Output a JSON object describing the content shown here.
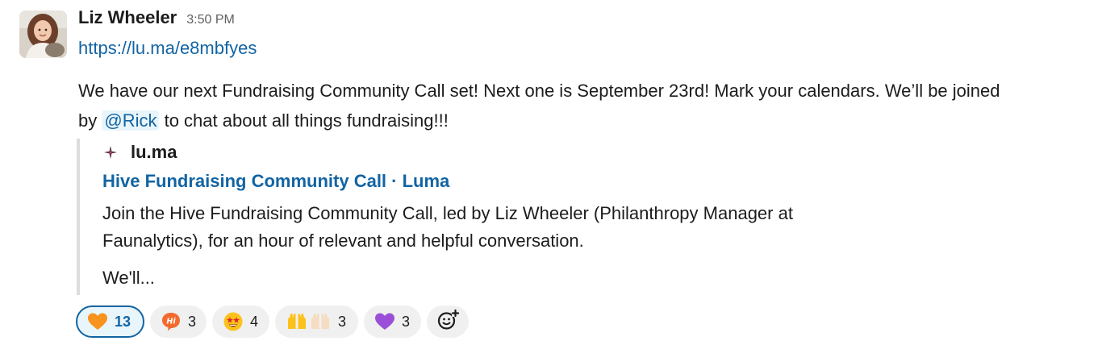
{
  "message": {
    "author": "Liz Wheeler",
    "time": "3:50 PM",
    "link": "https://lu.ma/e8mbfyes",
    "text_line1": "We have our next Fundraising Community Call set! Next one is September 23rd! Mark your calendars. We’ll be joined",
    "text_line2_prefix": "by ",
    "mention": "@Rick",
    "text_line2_suffix": " to chat about all things fundraising!!!"
  },
  "unfurl": {
    "site_icon": "luma-sparkle-icon",
    "site_name": "lu.ma",
    "title": "Hive Fundraising Community Call · Luma",
    "desc_line1": "Join the Hive Fundraising Community Call, led by Liz Wheeler (Philanthropy Manager at",
    "desc_line2": "Faunalytics), for an hour of relevant and helpful conversation.",
    "more": "We'll..."
  },
  "reactions": [
    {
      "emoji": "orange-heart-icon",
      "count": "13",
      "active": true
    },
    {
      "emoji": "hi-speech-bubble-icon",
      "count": "3",
      "active": false
    },
    {
      "emoji": "star-struck-face-icon",
      "count": "4",
      "active": false
    },
    {
      "emoji": "raised-hands-icon",
      "count": "3",
      "active": false
    },
    {
      "emoji": "purple-heart-icon",
      "count": "3",
      "active": false
    }
  ],
  "add_reaction_icon": "add-reaction-icon",
  "colors": {
    "link": "#1264a3",
    "mention_bg": "#e8f5fa",
    "active_reaction_border": "#1264a3",
    "reaction_bg": "#f0f0f0",
    "unfurl_bar": "#dddddd"
  }
}
